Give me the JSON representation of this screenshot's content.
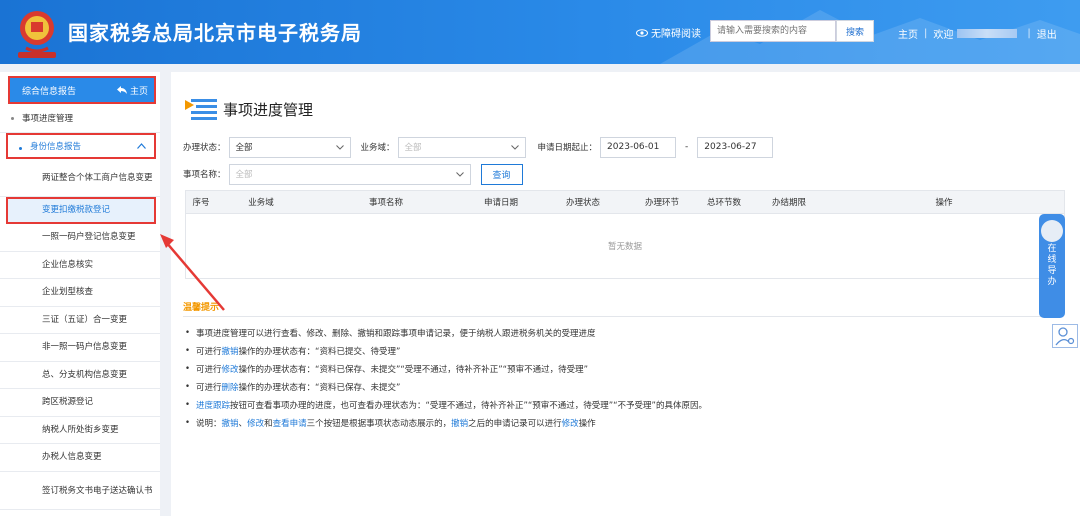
{
  "header": {
    "title": "国家税务总局北京市电子税务局",
    "accessibility": "无障碍阅读",
    "search_placeholder": "请输入需要搜索的内容",
    "search_button": "搜索",
    "home": "主页",
    "welcome": "欢迎",
    "logout": "退出",
    "sep": "|"
  },
  "sidebar": {
    "header_title": "综合信息报告",
    "header_home": "主页",
    "items": [
      {
        "label": "事项进度管理"
      },
      {
        "label": "身份信息报告"
      },
      {
        "label": "两证整合个体工商户信息变更"
      },
      {
        "label": "变更扣缴税款登记"
      },
      {
        "label": "一照一码户登记信息变更"
      },
      {
        "label": "企业信息核实"
      },
      {
        "label": "企业划型核查"
      },
      {
        "label": "三证（五证）合一变更"
      },
      {
        "label": "非一照一码户信息变更"
      },
      {
        "label": "总、分支机构信息变更"
      },
      {
        "label": "跨区税源登记"
      },
      {
        "label": "纳税人所处街乡变更"
      },
      {
        "label": "办税人信息变更"
      },
      {
        "label": "签订税务文书电子送达确认书"
      }
    ]
  },
  "main": {
    "title": "事项进度管理",
    "filters": {
      "status_label": "办理状态：",
      "status_value": "全部",
      "domain_label": "业务域：",
      "domain_value": "全部",
      "date_label": "申请日期起止：",
      "date_from": "2023-06-01",
      "date_dash": "-",
      "date_to": "2023-06-27",
      "name_label": "事项名称：",
      "name_value": "全部",
      "query_button": "查询"
    },
    "table": {
      "columns": [
        "序号",
        "业务域",
        "事项名称",
        "申请日期",
        "办理状态",
        "办理环节",
        "总环节数",
        "办结期限",
        "操作"
      ],
      "empty_text": "暂无数据"
    },
    "tips": {
      "title": "温馨提示",
      "lines": [
        {
          "a": "事项进度管理可以进行查看、修改、删除、撤销和跟踪事项申请记录，便于纳税人跟进税务机关的受理进度"
        },
        {
          "a": "可进行",
          "b": "撤销",
          "c": "操作的办理状态有：“资料已提交、待受理”"
        },
        {
          "a": "可进行",
          "b": "修改",
          "c": "操作的办理状态有：“资料已保存、未提交”“受理不通过，待补齐补正”“预审不通过，待受理”"
        },
        {
          "a": "可进行",
          "b": "删除",
          "c": "操作的办理状态有：“资料已保存、未提交”"
        },
        {
          "b": "进度跟踪",
          "c": "按钮可查看事项办理的进度，也可查看办理状态为：“受理不通过，待补齐补正”“预审不通过，待受理”“不予受理”的具体原因。"
        },
        {
          "a": "说明：",
          "b": "撤销",
          "c": "、",
          "d": "修改",
          "e": "和",
          "f": "查看申请",
          "g": "三个按钮是根据事项状态动态展示的，",
          "h": "撤销",
          "i": "之后的申请记录可以进行",
          "j": "修改",
          "k": "操作"
        }
      ]
    }
  },
  "float": {
    "guide_text": [
      "在",
      "线",
      "导",
      "办"
    ]
  },
  "colors": {
    "brand_blue": "#2a8ae8",
    "link_blue": "#1f7ad8",
    "highlight_red": "#e53935",
    "tips_orange": "#f39800"
  }
}
